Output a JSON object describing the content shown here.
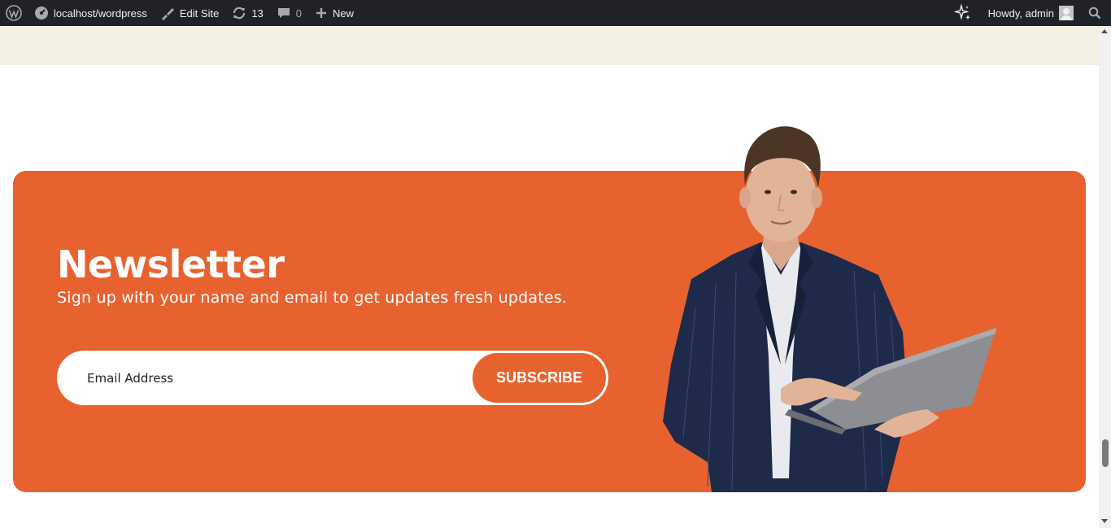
{
  "adminbar": {
    "site_label": "localhost/wordpress",
    "edit_site_label": "Edit Site",
    "updates_count": "13",
    "comments_count": "0",
    "new_label": "New",
    "greeting": "Howdy, admin"
  },
  "newsletter": {
    "title": "Newsletter",
    "subtitle": "Sign up with your name and email to get updates fresh updates.",
    "email_placeholder": "Email Address",
    "email_value": "",
    "subscribe_label": "SUBSCRIBE"
  },
  "colors": {
    "accent": "#e8622f",
    "adminbar_bg": "#1d2327",
    "band_bg": "#f3f0e4"
  },
  "icons": {
    "wp_logo": "wordpress-logo-icon",
    "site": "dashboard-icon",
    "edit_site": "brush-icon",
    "updates": "refresh-icon",
    "comments": "comment-icon",
    "new": "plus-icon",
    "ai": "sparkle-icon",
    "search": "search-icon"
  }
}
